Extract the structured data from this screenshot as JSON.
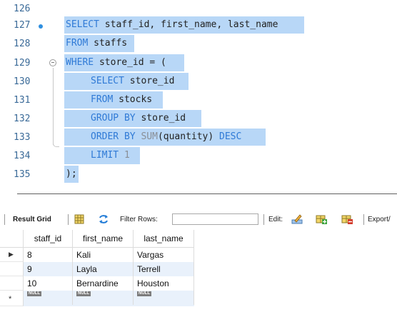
{
  "editor": {
    "lines": [
      {
        "n": "126"
      },
      {
        "n": "127"
      },
      {
        "n": "128"
      },
      {
        "n": "129"
      },
      {
        "n": "130"
      },
      {
        "n": "131"
      },
      {
        "n": "132"
      },
      {
        "n": "133"
      },
      {
        "n": "134"
      },
      {
        "n": "135"
      }
    ],
    "tokens": {
      "l127_a": "SELECT",
      "l127_b": " staff_id, first_name, last_name",
      "l128_a": "FROM",
      "l128_b": " staffs",
      "l129_a": "WHERE",
      "l129_b": " store_id = (",
      "l130_a": "SELECT",
      "l130_b": " store_id",
      "l131_a": "FROM",
      "l131_b": " stocks",
      "l132_a": "GROUP BY",
      "l132_b": " store_id",
      "l133_a": "ORDER BY",
      "l133_fn": " SUM",
      "l133_b": "(quantity) ",
      "l133_c": "DESC",
      "l134_a": "LIMIT",
      "l134_num": " 1",
      "l135_a": ");"
    },
    "selection_color": "#b8d7f7",
    "keyword_color": "#2f7ad6"
  },
  "toolbar": {
    "result_tab": "Result Grid",
    "filter_label": "Filter Rows:",
    "filter_value": "",
    "edit_label": "Edit:",
    "export_label": "Export/"
  },
  "grid": {
    "columns": [
      "staff_id",
      "first_name",
      "last_name"
    ],
    "rows": [
      [
        "8",
        "Kali",
        "Vargas"
      ],
      [
        "9",
        "Layla",
        "Terrell"
      ],
      [
        "10",
        "Bernardine",
        "Houston"
      ]
    ],
    "null_label": "NULL",
    "current_row_marker": "▶",
    "new_row_marker": "*",
    "alt_row_color": "#e9f1fb"
  }
}
